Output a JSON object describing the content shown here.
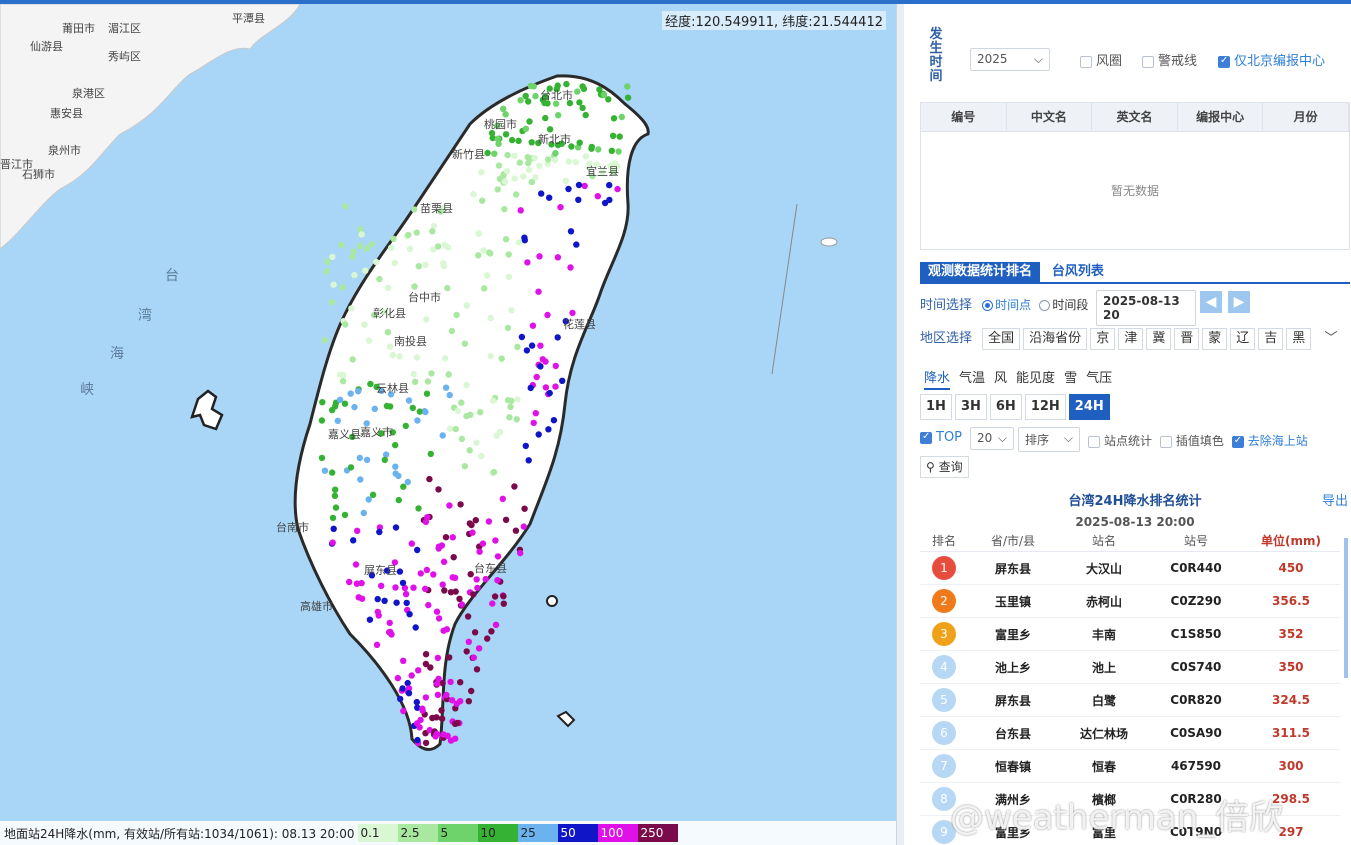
{
  "coord_readout": "经度:120.549911, 纬度:21.544412",
  "map_labels": [
    {
      "text": "莆田市"
    },
    {
      "text": "湄江区"
    },
    {
      "text": "平潭县"
    },
    {
      "text": "仙游县"
    },
    {
      "text": "秀屿区"
    },
    {
      "text": "泉港区"
    },
    {
      "text": "惠安县"
    },
    {
      "text": "泉州市"
    },
    {
      "text": "晋江市"
    },
    {
      "text": "石狮市"
    },
    {
      "text": "台北市"
    },
    {
      "text": "桃园市"
    },
    {
      "text": "新北市"
    },
    {
      "text": "新竹县"
    },
    {
      "text": "宜兰县"
    },
    {
      "text": "苗栗县"
    },
    {
      "text": "台中市"
    },
    {
      "text": "彰化县"
    },
    {
      "text": "南投县"
    },
    {
      "text": "花莲县"
    },
    {
      "text": "云林县"
    },
    {
      "text": "嘉义县"
    },
    {
      "text": "嘉义市"
    },
    {
      "text": "台南市"
    },
    {
      "text": "屏东县"
    },
    {
      "text": "台东县"
    },
    {
      "text": "高雄市"
    },
    {
      "text": "台"
    },
    {
      "text": "湾"
    },
    {
      "text": "海"
    },
    {
      "text": "峡"
    }
  ],
  "legend": {
    "label": "地面站24H降水(mm, 有效站/所有站:1034/1061): 08.13 20:00",
    "bins": [
      {
        "value": "0.1",
        "color": "#d8f7d2"
      },
      {
        "value": "2.5",
        "color": "#a9e8a0"
      },
      {
        "value": "5",
        "color": "#6ed36a"
      },
      {
        "value": "10",
        "color": "#35b233"
      },
      {
        "value": "25",
        "color": "#6bb3ee"
      },
      {
        "value": "50",
        "color": "#1016c8"
      },
      {
        "value": "100",
        "color": "#e010e8"
      },
      {
        "value": "250",
        "color": "#7a0a4a"
      }
    ]
  },
  "panel": {
    "time_label": "发生时间",
    "year": "2025",
    "checkboxes": [
      {
        "label": "风圈",
        "checked": false
      },
      {
        "label": "警戒线",
        "checked": false
      },
      {
        "label": "仅北京编报中心",
        "checked": true
      }
    ],
    "typhoon_table": {
      "headers": [
        "编号",
        "中文名",
        "英文名",
        "编报中心",
        "月份"
      ],
      "empty": "暂无数据"
    },
    "tabs": [
      "观测数据统计排名",
      "台风列表"
    ],
    "time_select_label": "时间选择",
    "time_point": "时间点",
    "time_range": "时间段",
    "datetime": "2025-08-13 20",
    "region_label": "地区选择",
    "regions": [
      "全国",
      "沿海省份",
      "京",
      "津",
      "冀",
      "晋",
      "蒙",
      "辽",
      "吉",
      "黑"
    ],
    "elements": [
      "降水",
      "气温",
      "风",
      "能见度",
      "雪",
      "气压"
    ],
    "durations": [
      "1H",
      "3H",
      "6H",
      "12H",
      "24H"
    ],
    "top_label": "TOP",
    "top_n": "20",
    "sort_label": "排序",
    "station_stats": "站点统计",
    "interp_fill": "插值填色",
    "remove_sea": "去除海上站",
    "query": "查询",
    "rank_title": "台湾24H降水排名统计",
    "export": "导出",
    "rank_date": "2025-08-13 20:00",
    "rank_headers": [
      "排名",
      "省/市/县",
      "站名",
      "站号",
      "单位(mm)"
    ],
    "rank_rows": [
      {
        "rank": "1",
        "county": "屏东县",
        "name": "大汉山",
        "id": "C0R440",
        "value": "450",
        "color": "#e84c3d"
      },
      {
        "rank": "2",
        "county": "玉里镇",
        "name": "赤柯山",
        "id": "C0Z290",
        "value": "356.5",
        "color": "#f07a1a"
      },
      {
        "rank": "3",
        "county": "富里乡",
        "name": "丰南",
        "id": "C1S850",
        "value": "352",
        "color": "#f0a11a"
      },
      {
        "rank": "4",
        "county": "池上乡",
        "name": "池上",
        "id": "C0S740",
        "value": "350",
        "color": "#b7d8f4"
      },
      {
        "rank": "5",
        "county": "屏东县",
        "name": "白鹭",
        "id": "C0R820",
        "value": "324.5",
        "color": "#b7d8f4"
      },
      {
        "rank": "6",
        "county": "台东县",
        "name": "达仁林场",
        "id": "C0SA90",
        "value": "311.5",
        "color": "#b7d8f4"
      },
      {
        "rank": "7",
        "county": "恒春镇",
        "name": "恒春",
        "id": "467590",
        "value": "300",
        "color": "#b7d8f4"
      },
      {
        "rank": "8",
        "county": "满州乡",
        "name": "檳榔",
        "id": "C0R280",
        "value": "298.5",
        "color": "#b7d8f4"
      },
      {
        "rank": "9",
        "county": "富里乡",
        "name": "富里",
        "id": "C0T9N0",
        "value": "297",
        "color": "#b7d8f4"
      }
    ]
  },
  "watermark": "@weatherman_倍欣"
}
